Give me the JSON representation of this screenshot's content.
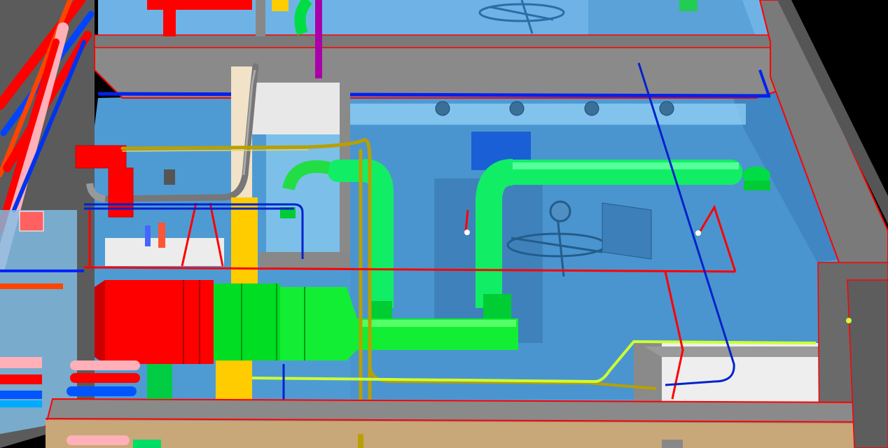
{
  "viewport": {
    "kind": "3d-bim-mep-model",
    "background": "#000000"
  },
  "colors": {
    "room_glass": "#5aa7de",
    "room_glass_dark": "#3f86c2",
    "slab": "#808080",
    "slab_edge": "#ff0000",
    "wall_white": "#e8e8e8",
    "fire_pipe": "#ff0000",
    "chilled_water": "#0000ff",
    "supply_duct": "#00ff66",
    "exhaust_duct": "#00ee00",
    "mixing_box": "#ff0000",
    "yellow_column": "#ffcc00",
    "gas_pipe": "#b8a000",
    "condensate": "#ccff33",
    "drain_pipe": "#777777",
    "purple_pipe": "#aa00aa",
    "pink_pipe": "#ffb0b8",
    "floor": "#c8a878"
  },
  "elements": {
    "ahu": "air-handling-unit",
    "supply_duct": "supply-air-duct",
    "return_duct": "return-air-duct",
    "fans": "ceiling-fan",
    "grilles": "ceiling-diffuser",
    "risers": "vertical-pipe-riser"
  }
}
